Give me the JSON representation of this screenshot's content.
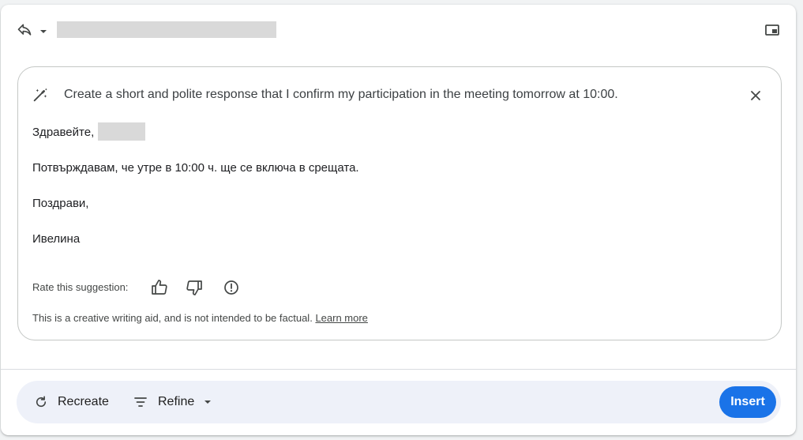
{
  "header": {
    "reply_icon": "reply-arrow-icon",
    "reply_menu_icon": "caret-down-icon",
    "popout_icon": "popout-window-icon"
  },
  "suggestion": {
    "icon": "magic-wand-icon",
    "prompt": "Create a short and polite response that I confirm my participation in the meeting tomorrow at 10:00.",
    "close_icon": "close-icon",
    "greeting": "Здравейте,",
    "body": "Потвърждавам, че утре в 10:00 ч. ще се включа в срещата.",
    "closing": "Поздрави,",
    "signature": "Ивелина",
    "rate_label": "Rate this suggestion:",
    "rate_icons": [
      "thumbs-up-icon",
      "thumbs-down-icon",
      "report-icon"
    ],
    "disclaimer": "This is a creative writing aid, and is not intended to be factual.",
    "learn_more": "Learn more"
  },
  "footer": {
    "recreate_label": "Recreate",
    "refine_label": "Refine",
    "insert_label": "Insert",
    "accent_color": "#1a73e8",
    "footer_bg": "#eef1f9"
  }
}
